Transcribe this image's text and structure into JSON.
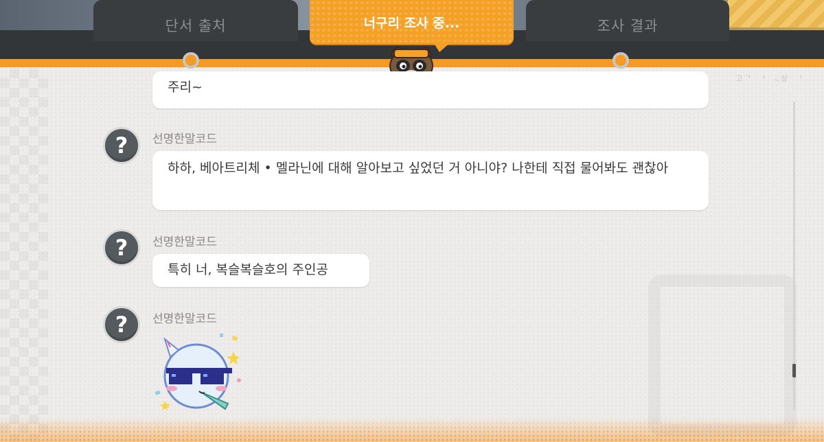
{
  "header": {
    "tabs": [
      {
        "label": "단서 출처"
      },
      {
        "label": "너구리 조사 중..."
      },
      {
        "label": "조사 결과"
      }
    ],
    "watermark": "고ᄀ ᅡ ᆨ상 ᅵ"
  },
  "chat": {
    "previous_tail": "주리~",
    "messages": [
      {
        "sender": "선명한말코드",
        "avatar_glyph": "?",
        "text": "하하, 베아트리체 • 멜라닌에 대해 알아보고 싶었던 거 아니야? 나한테 직접 물어봐도 괜찮아"
      },
      {
        "sender": "선명한말코드",
        "avatar_glyph": "?",
        "text": "특히 너, 복슬복슬호의 주인공"
      },
      {
        "sender": "선명한말코드",
        "avatar_glyph": "?",
        "sticker": "cool-sunglasses-party-sticker"
      }
    ]
  },
  "colors": {
    "accent": "#f59a22",
    "header_dark": "#333638",
    "avatar": "#555a5e"
  }
}
